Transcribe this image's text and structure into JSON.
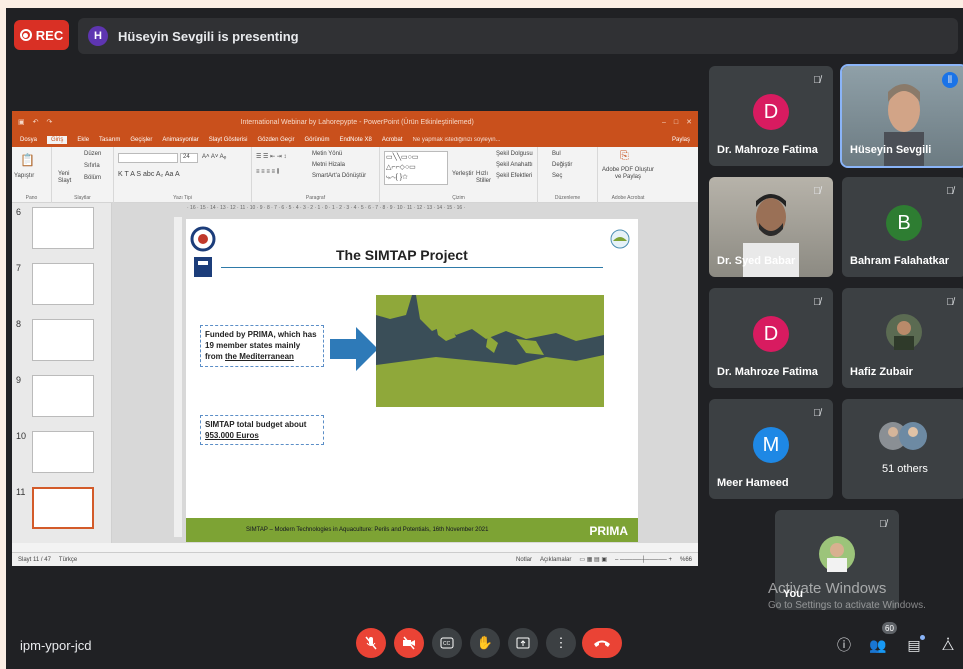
{
  "top": {
    "rec_label": "REC",
    "presenter_initial": "H",
    "presenter_text": "Hüseyin Sevgili is presenting"
  },
  "ppt": {
    "window_title": "International Webinar by Lahorepypte - PowerPoint (Ürün Etkinleştirilemed)",
    "tabs": [
      "Dosya",
      "Giriş",
      "Ekle",
      "Tasarım",
      "Geçişler",
      "Animasyonlar",
      "Slayt Gösterisi",
      "Gözden Geçir",
      "Görünüm",
      "EndNote X8",
      "Acrobat"
    ],
    "search_hint": "Ne yapmak istediğinizi söyleyin...",
    "share": "Paylaş",
    "ribbon": {
      "paste": "Yapıştır",
      "new_slide": "Yeni Slayt",
      "layout": "Düzen",
      "reset": "Sıfırla",
      "section": "Bölüm",
      "font_size": "24",
      "text_direction": "Metin Yönü",
      "align_text": "Metni Hizala",
      "smartart": "SmartArt'a Dönüştür",
      "arrange": "Yerleştir",
      "quick_styles": "Hızlı Stiller",
      "shape_fill": "Şekil Dolgusu",
      "shape_outline": "Şekil Anahattı",
      "shape_effects": "Şekil Efektleri",
      "find": "Bul",
      "replace": "Değiştir",
      "select": "Seç",
      "adobe": "Adobe PDF Oluştur ve Paylaş",
      "group_labels": [
        "Pano",
        "Slaytlar",
        "Yazı Tipi",
        "Paragraf",
        "Çizim",
        "Düzenleme",
        "Adobe Acrobat"
      ]
    },
    "thumb_numbers": [
      "6",
      "7",
      "8",
      "9",
      "10",
      "11"
    ],
    "ruler": "· 16 · 15 · 14 · 13 · 12 · 11 · 10 · 9 · 8 · 7 · 6 · 5 · 4 · 3 · 2 · 1 · 0 · 1 · 2 · 3 · 4 · 5 · 6 · 7 · 8 · 9 · 10 · 11 · 12 · 13 · 14 · 15 · 16 ·",
    "slide": {
      "title": "The SIMTAP Project",
      "box1_a": "Funded by PRIMA, which has 19 member states mainly from ",
      "box1_b": "the Mediterranean",
      "box2_a": "SIMTAP total budget about ",
      "box2_b": "953.000 Euros",
      "footer": "SIMTAP – Modern Technologies in Aquaculture: Perils and Potentials, 16th November 2021",
      "prima": "PRIMA"
    },
    "status": {
      "slide_count": "Slayt 11 / 47",
      "language": "Türkçe",
      "notes": "Notlar",
      "comments": "Açıklamalar",
      "zoom": "%66"
    }
  },
  "participants": [
    {
      "name": "Dr. Mahroze Fatima",
      "initial": "D",
      "color": "#d81b60"
    },
    {
      "name": "Hüseyin Sevgili",
      "initial": "",
      "color": ""
    },
    {
      "name": "Dr. Syed Babar",
      "initial": "",
      "color": ""
    },
    {
      "name": "Bahram Falahatkar",
      "initial": "B",
      "color": "#2e7d32"
    },
    {
      "name": "Dr. Mahroze Fatima",
      "initial": "D",
      "color": "#d81b60"
    },
    {
      "name": "Hafiz Zubair",
      "initial": "",
      "color": ""
    },
    {
      "name": "Meer Hameed",
      "initial": "M",
      "color": "#1e88e5"
    },
    {
      "name": "51 others",
      "initial": "",
      "color": ""
    },
    {
      "name": "You",
      "initial": "",
      "color": ""
    }
  ],
  "watermark": {
    "line1": "Activate Windows",
    "line2": "Go to Settings to activate Windows."
  },
  "bottom": {
    "meeting_code": "ipm-ypor-jcd",
    "people_count": "60"
  }
}
